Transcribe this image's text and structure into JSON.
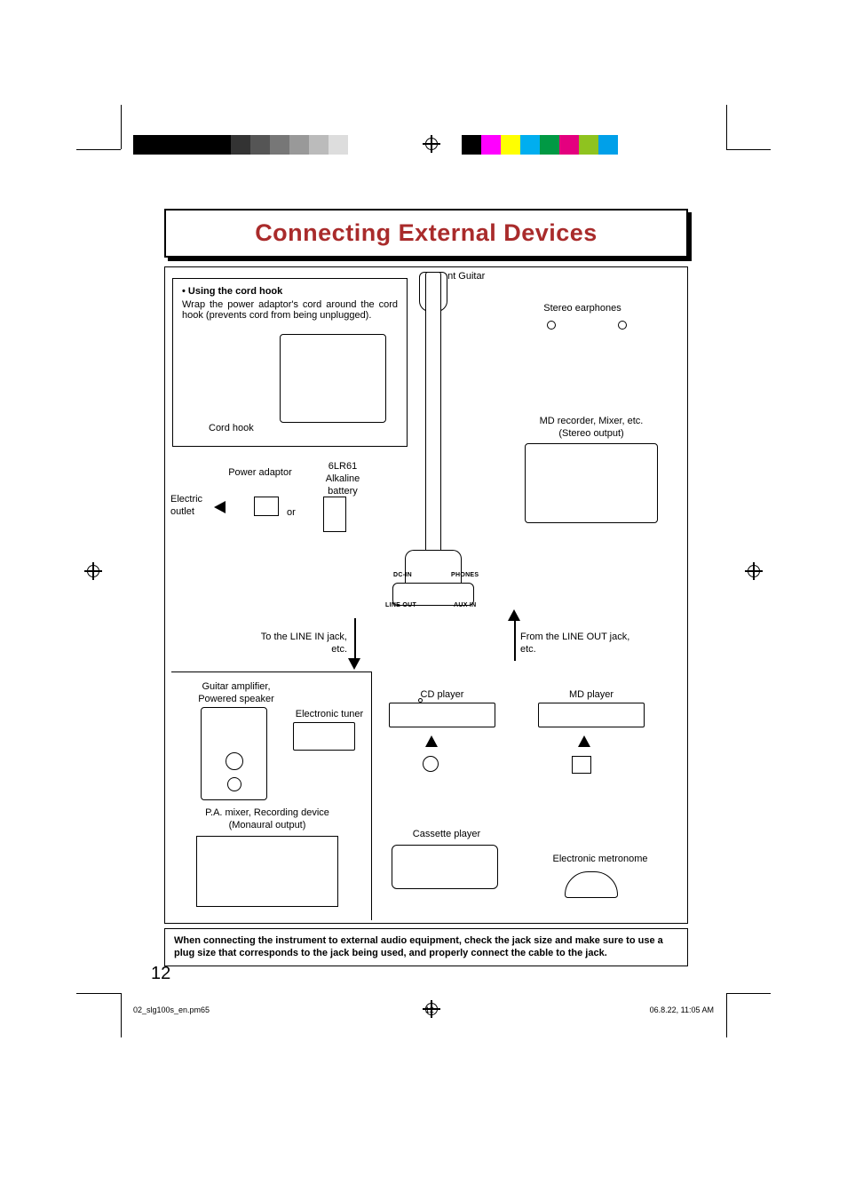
{
  "title": "Connecting External Devices",
  "cordhook": {
    "heading": "• Using the cord hook",
    "body": "Wrap the power adaptor's cord around the cord hook (prevents cord from being unplugged).",
    "label": "Cord hook"
  },
  "labels": {
    "silent_guitar": "Silent Guitar",
    "stereo_earphones": "Stereo earphones",
    "md_recorder": "MD recorder, Mixer, etc.",
    "stereo_output": "(Stereo output)",
    "power_adaptor": "Power adaptor",
    "battery": "6LR61\nAlkaline\nbattery",
    "electric_outlet": "Electric\noutlet",
    "or": "or",
    "to_line_in": "To the LINE IN jack,\netc.",
    "from_line_out": "From the LINE OUT jack,\netc.",
    "guitar_amp": "Guitar amplifier,\nPowered speaker",
    "electronic_tuner": "Electronic tuner",
    "pa_mixer": "P.A. mixer, Recording device\n(Monaural output)",
    "cd_player": "CD player",
    "md_player": "MD player",
    "cassette_player": "Cassette player",
    "electronic_metronome": "Electronic metronome"
  },
  "jacks": {
    "dcin": "DC-IN",
    "phones": "PHONES",
    "lineout": "LINE OUT",
    "auxin": "AUX IN"
  },
  "warning": "When connecting the instrument to external audio equipment, check the jack size and make sure to use a plug size that corresponds to the jack being used, and properly connect the cable to the jack.",
  "page_number": "12",
  "footer": {
    "file": "02_slg100s_en.pm65",
    "page": "12",
    "timestamp": "06.8.22, 11:05 AM"
  },
  "colorbar": [
    "#000",
    "#ff00ff",
    "#ffff00",
    "#00aeef",
    "#009944",
    "#e4007f",
    "#8fc31f",
    "#00a0e9"
  ],
  "graybar": [
    "#000",
    "#000",
    "#000",
    "#000",
    "#000",
    "#333",
    "#555",
    "#777",
    "#999",
    "#bbb",
    "#ddd"
  ]
}
